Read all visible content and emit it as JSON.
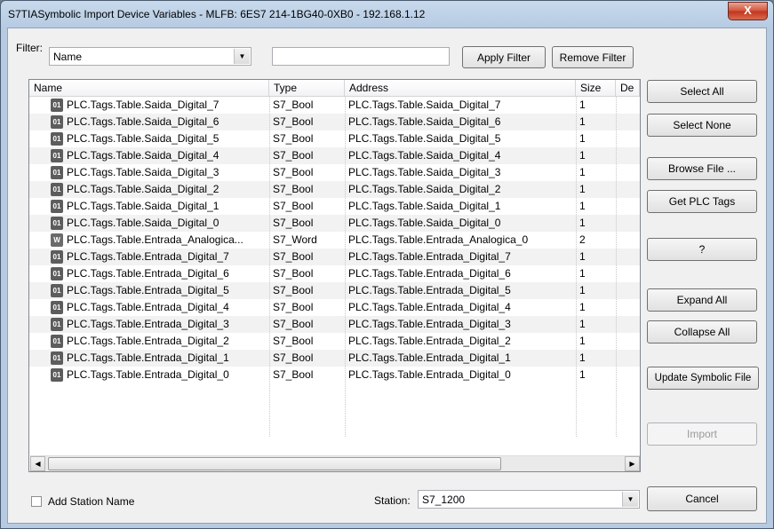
{
  "window": {
    "title": "S7TIASymbolic Import Device Variables - MLFB: 6ES7 214-1BG40-0XB0 - 192.168.1.12",
    "close_label": "X"
  },
  "filter": {
    "label": "Filter:",
    "field_value": "Name",
    "text_value": "",
    "apply_label": "Apply Filter",
    "remove_label": "Remove Filter"
  },
  "table": {
    "columns": [
      "Name",
      "Type",
      "Address",
      "Size",
      "De"
    ],
    "rows": [
      {
        "name": "PLC.Tags.Table.Saida_Digital_7",
        "type": "S7_Bool",
        "address": "PLC.Tags.Table.Saida_Digital_7",
        "size": "1",
        "icon": "01"
      },
      {
        "name": "PLC.Tags.Table.Saida_Digital_6",
        "type": "S7_Bool",
        "address": "PLC.Tags.Table.Saida_Digital_6",
        "size": "1",
        "icon": "01"
      },
      {
        "name": "PLC.Tags.Table.Saida_Digital_5",
        "type": "S7_Bool",
        "address": "PLC.Tags.Table.Saida_Digital_5",
        "size": "1",
        "icon": "01"
      },
      {
        "name": "PLC.Tags.Table.Saida_Digital_4",
        "type": "S7_Bool",
        "address": "PLC.Tags.Table.Saida_Digital_4",
        "size": "1",
        "icon": "01"
      },
      {
        "name": "PLC.Tags.Table.Saida_Digital_3",
        "type": "S7_Bool",
        "address": "PLC.Tags.Table.Saida_Digital_3",
        "size": "1",
        "icon": "01"
      },
      {
        "name": "PLC.Tags.Table.Saida_Digital_2",
        "type": "S7_Bool",
        "address": "PLC.Tags.Table.Saida_Digital_2",
        "size": "1",
        "icon": "01"
      },
      {
        "name": "PLC.Tags.Table.Saida_Digital_1",
        "type": "S7_Bool",
        "address": "PLC.Tags.Table.Saida_Digital_1",
        "size": "1",
        "icon": "01"
      },
      {
        "name": "PLC.Tags.Table.Saida_Digital_0",
        "type": "S7_Bool",
        "address": "PLC.Tags.Table.Saida_Digital_0",
        "size": "1",
        "icon": "01"
      },
      {
        "name": "PLC.Tags.Table.Entrada_Analogica...",
        "type": "S7_Word",
        "address": "PLC.Tags.Table.Entrada_Analogica_0",
        "size": "2",
        "icon": "W"
      },
      {
        "name": "PLC.Tags.Table.Entrada_Digital_7",
        "type": "S7_Bool",
        "address": "PLC.Tags.Table.Entrada_Digital_7",
        "size": "1",
        "icon": "01"
      },
      {
        "name": "PLC.Tags.Table.Entrada_Digital_6",
        "type": "S7_Bool",
        "address": "PLC.Tags.Table.Entrada_Digital_6",
        "size": "1",
        "icon": "01"
      },
      {
        "name": "PLC.Tags.Table.Entrada_Digital_5",
        "type": "S7_Bool",
        "address": "PLC.Tags.Table.Entrada_Digital_5",
        "size": "1",
        "icon": "01"
      },
      {
        "name": "PLC.Tags.Table.Entrada_Digital_4",
        "type": "S7_Bool",
        "address": "PLC.Tags.Table.Entrada_Digital_4",
        "size": "1",
        "icon": "01"
      },
      {
        "name": "PLC.Tags.Table.Entrada_Digital_3",
        "type": "S7_Bool",
        "address": "PLC.Tags.Table.Entrada_Digital_3",
        "size": "1",
        "icon": "01"
      },
      {
        "name": "PLC.Tags.Table.Entrada_Digital_2",
        "type": "S7_Bool",
        "address": "PLC.Tags.Table.Entrada_Digital_2",
        "size": "1",
        "icon": "01"
      },
      {
        "name": "PLC.Tags.Table.Entrada_Digital_1",
        "type": "S7_Bool",
        "address": "PLC.Tags.Table.Entrada_Digital_1",
        "size": "1",
        "icon": "01"
      },
      {
        "name": "PLC.Tags.Table.Entrada_Digital_0",
        "type": "S7_Bool",
        "address": "PLC.Tags.Table.Entrada_Digital_0",
        "size": "1",
        "icon": "01"
      }
    ]
  },
  "buttons": {
    "select_all": "Select All",
    "select_none": "Select None",
    "browse_file": "Browse File ...",
    "get_plc_tags": "Get PLC Tags",
    "help": "?",
    "expand_all": "Expand All",
    "collapse_all": "Collapse All",
    "update_symbolic_file": "Update Symbolic File",
    "import": "Import",
    "cancel": "Cancel"
  },
  "footer": {
    "add_station_label": "Add Station Name",
    "station_label": "Station:",
    "station_value": "S7_1200"
  },
  "icons": {
    "bool": "bool-tag-icon",
    "word": "word-tag-icon"
  }
}
